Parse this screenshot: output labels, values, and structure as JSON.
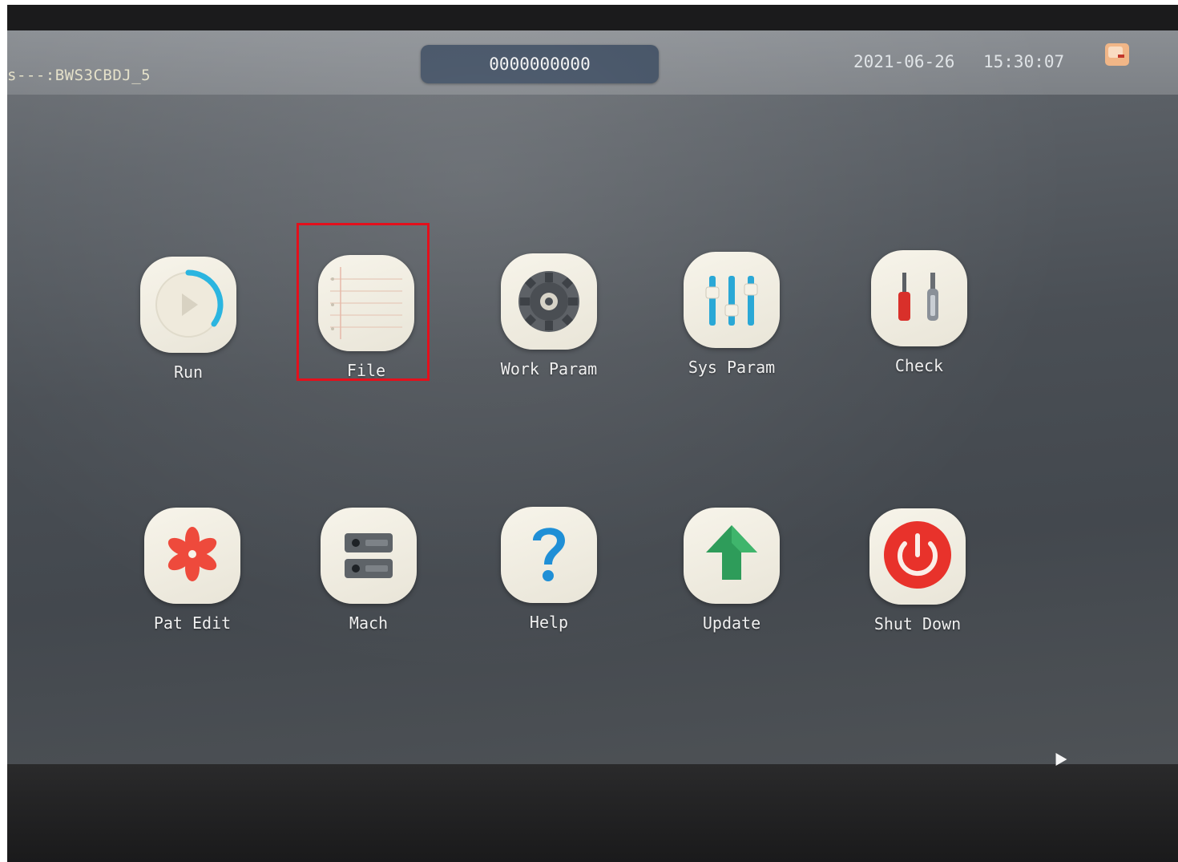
{
  "topbar": {
    "machine_id": "s---:BWS3CBDJ_5",
    "serial": "0000000000",
    "date": "2021-06-26",
    "time": "15:30:07"
  },
  "apps": [
    {
      "label": "Run",
      "icon": "play-progress-icon"
    },
    {
      "label": "File",
      "icon": "notepad-icon"
    },
    {
      "label": "Work Param",
      "icon": "gear-icon"
    },
    {
      "label": "Sys Param",
      "icon": "sliders-icon"
    },
    {
      "label": "Check",
      "icon": "tools-icon"
    },
    {
      "label": "Pat Edit",
      "icon": "flower-icon"
    },
    {
      "label": "Mach",
      "icon": "machine-icon"
    },
    {
      "label": "Help",
      "icon": "question-icon"
    },
    {
      "label": "Update",
      "icon": "up-arrow-icon"
    },
    {
      "label": "Shut Down",
      "icon": "power-icon"
    }
  ],
  "colors": {
    "accent_cyan": "#2bb5e0",
    "highlight_red": "#e3101c",
    "power_red": "#e8322b",
    "update_green": "#2e9c5a"
  }
}
